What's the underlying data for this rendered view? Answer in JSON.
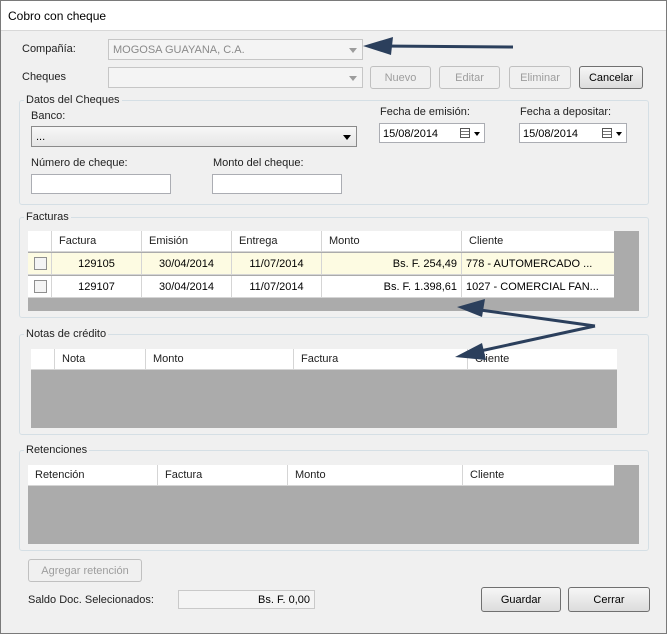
{
  "window": {
    "title": "Cobro con cheque"
  },
  "top": {
    "company_label": "Compañía:",
    "company_value": "MOGOSA GUAYANA, C.A.",
    "cheques_label": "Cheques",
    "cheques_value": "",
    "nuevo_label": "Nuevo",
    "editar_label": "Editar",
    "eliminar_label": "Eliminar",
    "cancelar_label": "Cancelar"
  },
  "datos": {
    "title": "Datos del Cheques",
    "banco_label": "Banco:",
    "banco_value": "...",
    "fecha_emision_label": "Fecha de emisión:",
    "fecha_emision_value": "15/08/2014",
    "fecha_depositar_label": "Fecha a depositar:",
    "fecha_depositar_value": "15/08/2014",
    "numero_label": "Número de cheque:",
    "numero_value": "",
    "monto_label": "Monto del cheque:",
    "monto_value": ""
  },
  "facturas": {
    "title": "Facturas",
    "columns": [
      "",
      "Factura",
      "Emisión",
      "Entrega",
      "Monto",
      "Cliente"
    ],
    "rows": [
      {
        "factura": "129105",
        "emision": "30/04/2014",
        "entrega": "11/07/2014",
        "monto": "Bs. F. 254,49",
        "cliente": "778 - AUTOMERCADO ..."
      },
      {
        "factura": "129107",
        "emision": "30/04/2014",
        "entrega": "11/07/2014",
        "monto": "Bs. F. 1.398,61",
        "cliente": "1027 - COMERCIAL FAN..."
      }
    ]
  },
  "notas": {
    "title": "Notas de crédito",
    "columns": [
      "",
      "Nota",
      "Monto",
      "Factura",
      "Cliente"
    ]
  },
  "retenciones": {
    "title": "Retenciones",
    "columns": [
      "Retención",
      "Factura",
      "Monto",
      "Cliente"
    ]
  },
  "footer": {
    "agregar_label": "Agregar retención",
    "saldo_label": "Saldo Doc. Selecionados:",
    "saldo_value": "Bs. F. 0,00",
    "guardar_label": "Guardar",
    "cerrar_label": "Cerrar"
  },
  "colors": {
    "annotation_arrow": "#2b3f5c",
    "grid_empty": "#ababab",
    "selected_row": "#fdfbe2"
  }
}
